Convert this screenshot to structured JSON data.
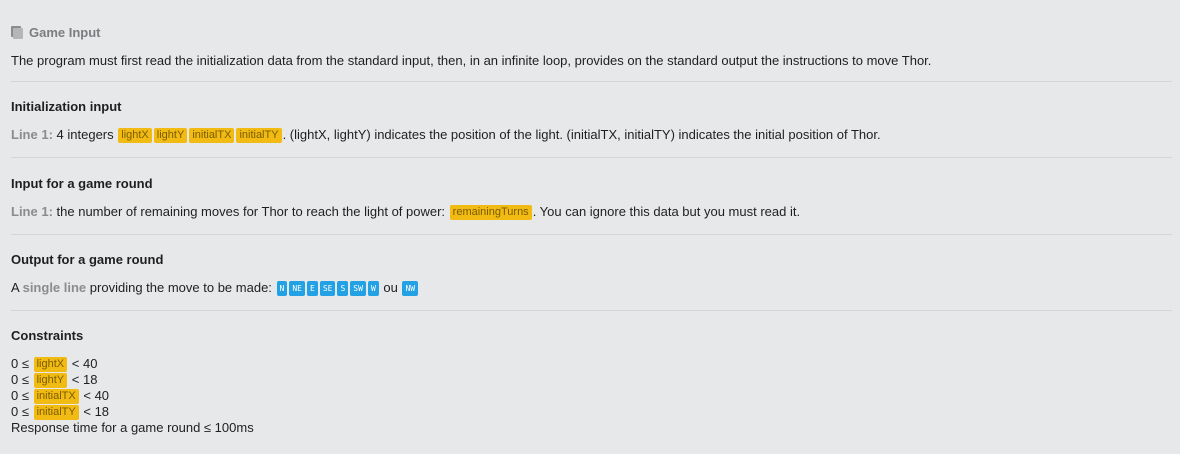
{
  "header": {
    "title": "Game Input"
  },
  "intro": "The program must first read the initialization data from the standard input, then, in an infinite loop, provides on the standard output the instructions to move Thor.",
  "init": {
    "heading": "Initialization input",
    "line_label": "Line 1:",
    "text_a": "4 integers",
    "vars": [
      "lightX",
      "lightY",
      "initialTX",
      "initialTY"
    ],
    "text_b": ". (lightX, lightY) indicates the position of the light. (initialTX, initialTY) indicates the initial position of Thor."
  },
  "round_input": {
    "heading": "Input for a game round",
    "line_label": "Line 1:",
    "text_a": "the number of remaining moves for Thor to reach the light of power:",
    "var": "remainingTurns",
    "text_b": ". You can ignore this data but you must read it."
  },
  "round_output": {
    "heading": "Output for a game round",
    "text_a": "A",
    "emph": "single line",
    "text_b": "providing the move to be made:",
    "dirs": [
      "N",
      "NE",
      "E",
      "SE",
      "S",
      "SW",
      "W"
    ],
    "or_word": "ou",
    "last_dir": "NW"
  },
  "constraints": {
    "heading": "Constraints",
    "rows": [
      {
        "pre": "0 ≤",
        "var": "lightX",
        "post": "< 40"
      },
      {
        "pre": "0 ≤",
        "var": "lightY",
        "post": "< 18"
      },
      {
        "pre": "0 ≤",
        "var": "initialTX",
        "post": "< 40"
      },
      {
        "pre": "0 ≤",
        "var": "initialTY",
        "post": "< 18"
      }
    ],
    "response_time": "Response time for a game round ≤ 100ms"
  }
}
